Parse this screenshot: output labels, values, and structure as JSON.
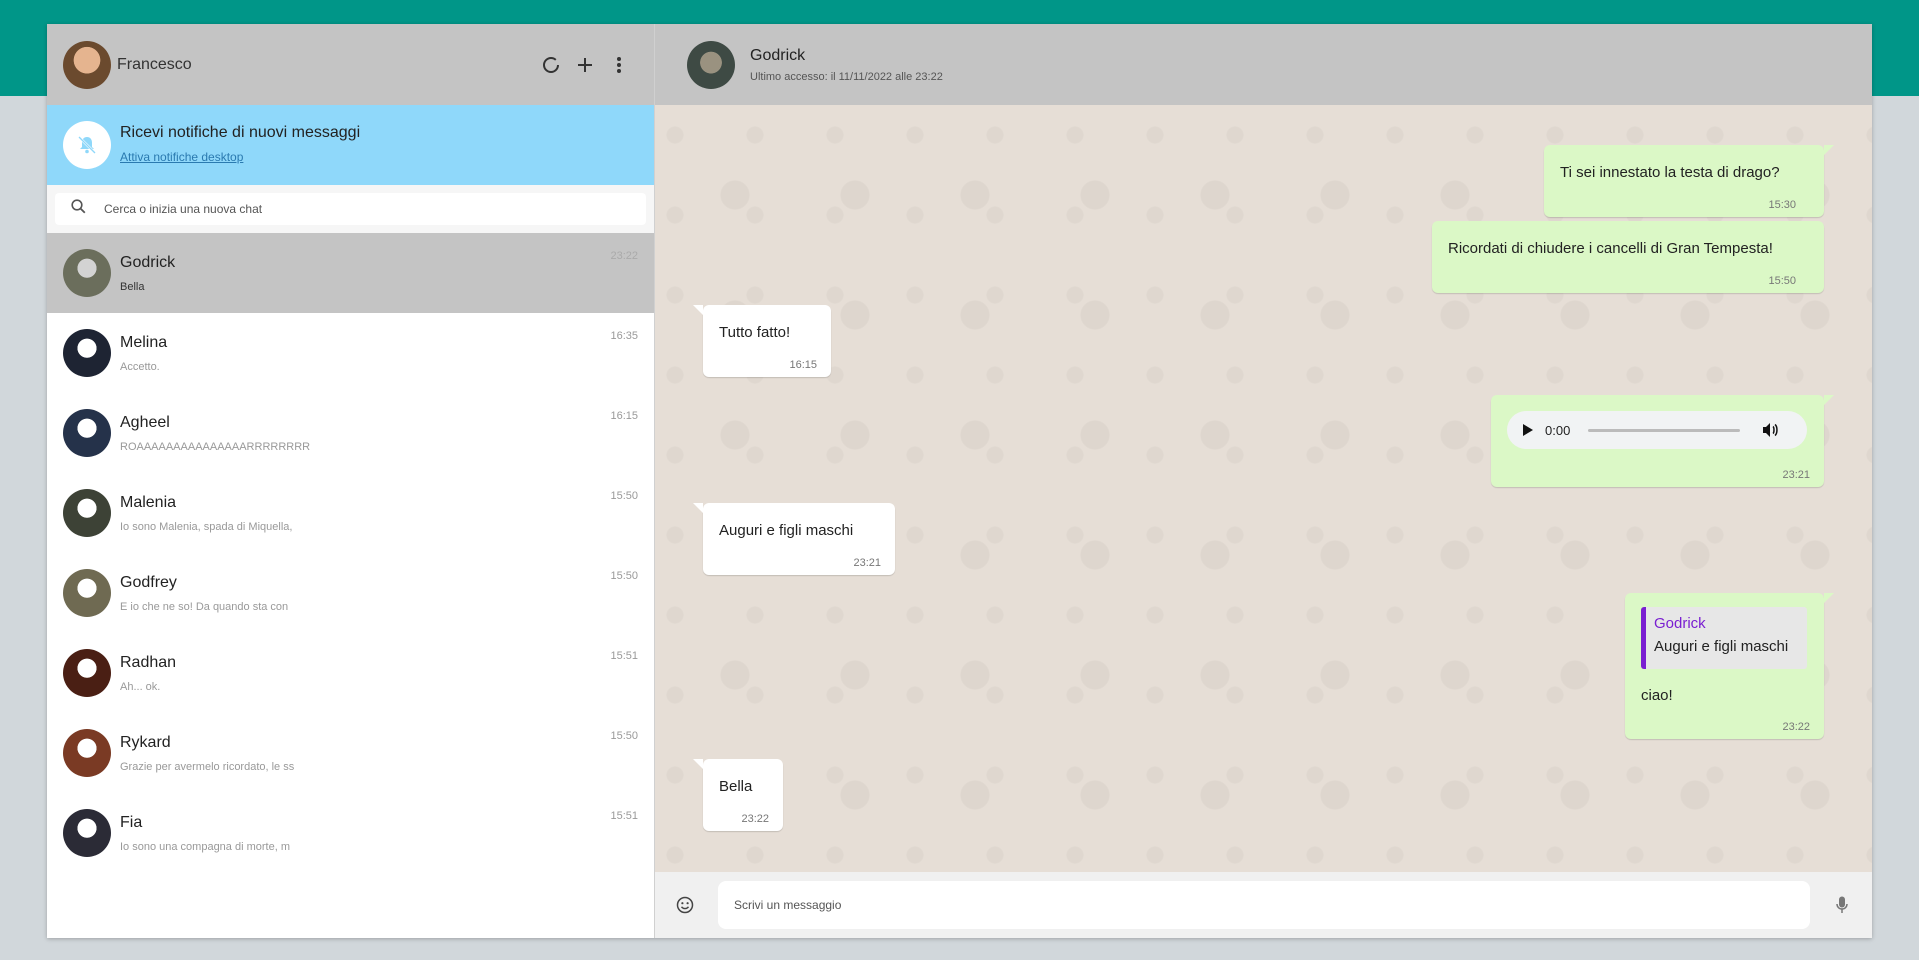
{
  "me": {
    "name": "Francesco"
  },
  "header_icons": [
    "status-icon",
    "new-chat-icon",
    "menu-icon"
  ],
  "notification": {
    "title": "Ricevi notifiche di nuovi messaggi",
    "link": "Attiva notifiche desktop"
  },
  "search": {
    "placeholder": "Cerca o inizia una nuova chat"
  },
  "chats": [
    {
      "name": "Godrick",
      "preview": "Bella",
      "time": "23:22",
      "active": true,
      "color": "#6b6e5c"
    },
    {
      "name": "Melina",
      "preview": "Accetto.",
      "time": "16:35",
      "color": "#1e2433"
    },
    {
      "name": "Agheel",
      "preview": "ROAAAAAAAAAAAAAAARRRRRRRR",
      "time": "16:15",
      "color": "#25324a"
    },
    {
      "name": "Malenia",
      "preview": "Io sono Malenia, spada di Miquella,",
      "time": "15:50",
      "color": "#3d4236"
    },
    {
      "name": "Godfrey",
      "preview": "E io che ne so! Da quando sta con",
      "time": "15:50",
      "color": "#6f6a52"
    },
    {
      "name": "Radhan",
      "preview": "Ah... ok.",
      "time": "15:51",
      "color": "#4a1f14"
    },
    {
      "name": "Rykard",
      "preview": "Grazie per avermelo ricordato, le ss",
      "time": "15:50",
      "color": "#7a3a24"
    },
    {
      "name": "Fia",
      "preview": "Io sono una compagna di morte, m",
      "time": "15:51",
      "color": "#2b2b36"
    }
  ],
  "conversation": {
    "name": "Godrick",
    "status": "Ultimo accesso: il 11/11/2022 alle 23:22"
  },
  "messages": [
    {
      "dir": "out",
      "text": "Ti sei innestato la testa di drago?",
      "time": "15:30"
    },
    {
      "dir": "out",
      "text": "Ricordati di chiudere i cancelli di Gran Tempesta!",
      "time": "15:50"
    },
    {
      "dir": "in",
      "text": "Tutto fatto!",
      "time": "16:15"
    },
    {
      "dir": "out",
      "audio_time": "0:00",
      "time": "23:21"
    },
    {
      "dir": "in",
      "text": "Auguri e figli maschi",
      "time": "23:21"
    },
    {
      "dir": "out",
      "quote_name": "Godrick",
      "quote_text": "Auguri e figli maschi",
      "text": "ciao!",
      "time": "23:22"
    },
    {
      "dir": "in",
      "text": "Bella",
      "time": "23:22"
    }
  ],
  "composer": {
    "placeholder": "Scrivi un messaggio"
  },
  "colors": {
    "teal": "#009688",
    "panel": "#c4c4c4",
    "notif": "#8fd8fa",
    "bubble_out": "#dbf8c6",
    "quote_bar": "#7a1fd1"
  }
}
